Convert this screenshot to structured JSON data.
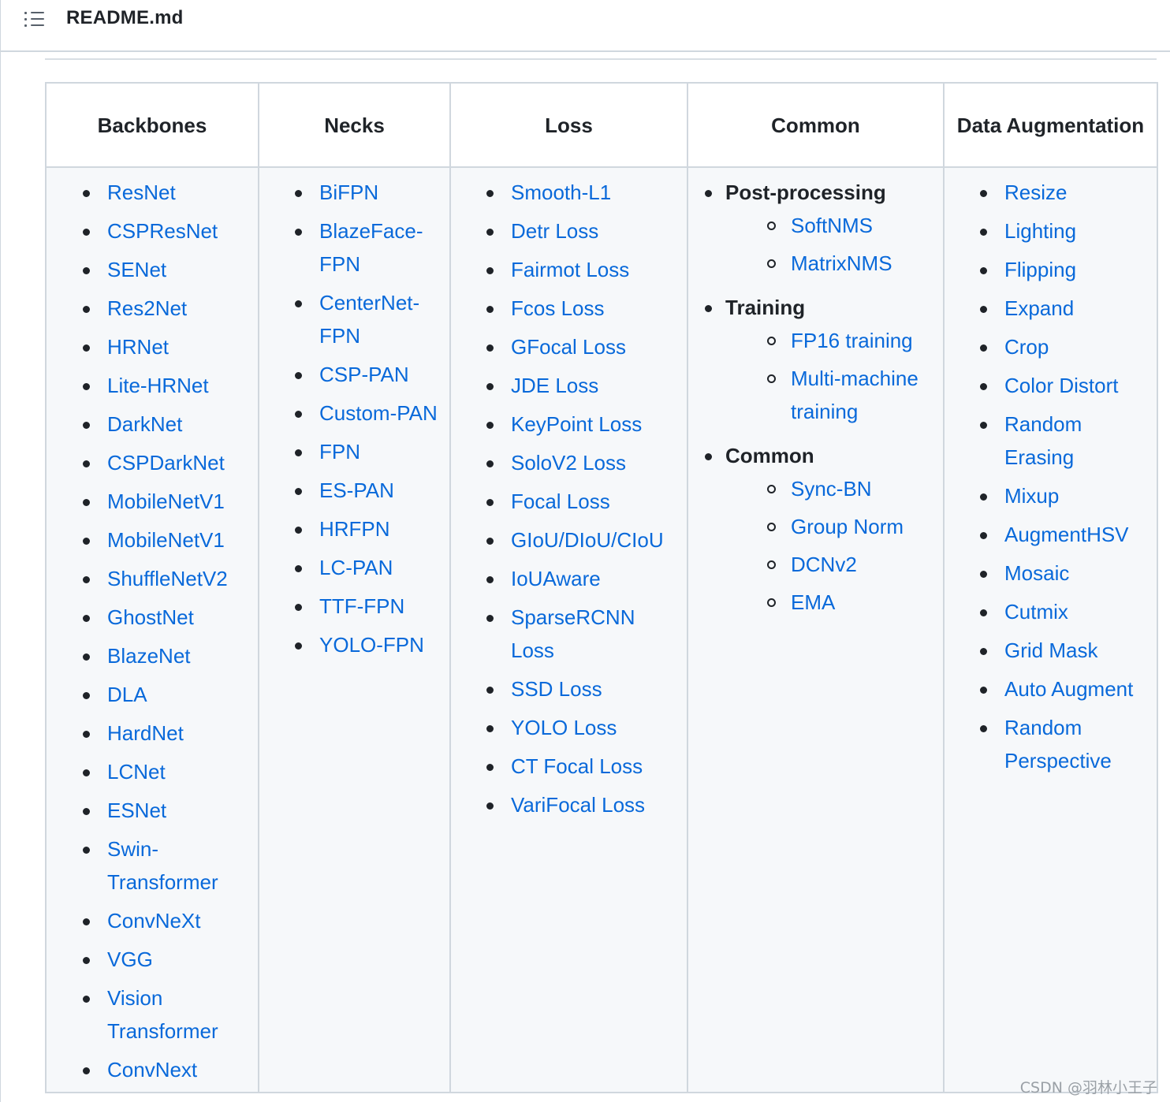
{
  "file": {
    "title": "README.md",
    "toc_icon": "list-unordered-icon"
  },
  "table": {
    "headers": [
      "Backbones",
      "Necks",
      "Loss",
      "Common",
      "Data Augmentation"
    ],
    "backbones": [
      "ResNet",
      "CSPResNet",
      "SENet",
      "Res2Net",
      "HRNet",
      "Lite-HRNet",
      "DarkNet",
      "CSPDarkNet",
      "MobileNetV1",
      "MobileNetV1",
      "ShuffleNetV2",
      "GhostNet",
      "BlazeNet",
      "DLA",
      "HardNet",
      "LCNet",
      "ESNet",
      "Swin-Transformer",
      "ConvNeXt",
      "VGG",
      "Vision Transformer",
      "ConvNext"
    ],
    "necks": [
      "BiFPN",
      "BlazeFace-FPN",
      "CenterNet-FPN",
      "CSP-PAN",
      "Custom-PAN",
      "FPN",
      "ES-PAN",
      "HRFPN",
      "LC-PAN",
      "TTF-FPN",
      "YOLO-FPN"
    ],
    "loss": [
      "Smooth-L1",
      "Detr Loss",
      "Fairmot Loss",
      "Fcos Loss",
      "GFocal Loss",
      "JDE Loss",
      "KeyPoint Loss",
      "SoloV2 Loss",
      "Focal Loss",
      "GIoU/DIoU/CIoU",
      "IoUAware",
      "SparseRCNN Loss",
      "SSD Loss",
      "YOLO Loss",
      "CT Focal Loss",
      "VariFocal Loss"
    ],
    "common": [
      {
        "label": "Post-processing",
        "items": [
          "SoftNMS",
          "MatrixNMS"
        ]
      },
      {
        "label": "Training",
        "items": [
          "FP16 training",
          "Multi-machine training"
        ]
      },
      {
        "label": "Common",
        "items": [
          "Sync-BN",
          "Group Norm",
          "DCNv2",
          "EMA"
        ]
      }
    ],
    "augmentation": [
      "Resize",
      "Lighting",
      "Flipping",
      "Expand",
      "Crop",
      "Color Distort",
      "Random Erasing",
      "Mixup",
      "AugmentHSV",
      "Mosaic",
      "Cutmix",
      "Grid Mask",
      "Auto Augment",
      "Random Perspective"
    ]
  },
  "watermark": "CSDN @羽林小王子",
  "colors": {
    "link": "#0969da",
    "text": "#1f2328",
    "border": "#d0d7de",
    "cell_bg": "#f6f8fa"
  }
}
